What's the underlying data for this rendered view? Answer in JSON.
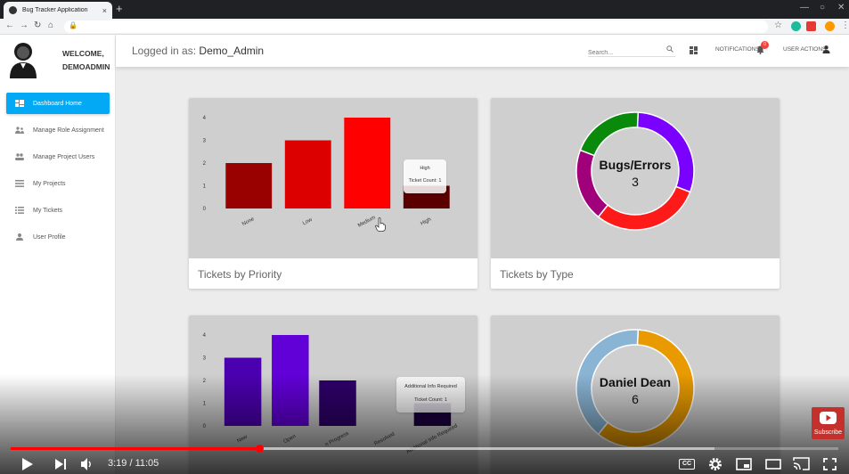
{
  "browser": {
    "tab_title": "Bug Tracker Application",
    "tab_close": "×",
    "new_tab": "+"
  },
  "sidebar": {
    "welcome": "WELCOME,",
    "username": "DEMOADMIN",
    "items": [
      {
        "label": "Dashboard Home",
        "icon": "dashboard-icon"
      },
      {
        "label": "Manage Role Assignment",
        "icon": "people-icon"
      },
      {
        "label": "Manage Project Users",
        "icon": "group-icon"
      },
      {
        "label": "My Projects",
        "icon": "list-icon"
      },
      {
        "label": "My Tickets",
        "icon": "list-icon"
      },
      {
        "label": "User Profile",
        "icon": "person-icon"
      }
    ]
  },
  "header": {
    "logged_prefix": "Logged in as:",
    "logged_user": "Demo_Admin",
    "search_placeholder": "Search...",
    "notifications": "NOTIFICATIONS",
    "notifications_count": "0",
    "user_actions": "USER ACTIONS"
  },
  "cards": {
    "priority_title": "Tickets by Priority",
    "type_title": "Tickets by Type"
  },
  "chart_data": [
    {
      "type": "bar",
      "categories": [
        "None",
        "Low",
        "Medium",
        "High"
      ],
      "values": [
        2,
        3,
        4,
        1
      ],
      "colors": [
        "#990000",
        "#dd0000",
        "#ff0000",
        "#5a0000"
      ],
      "ylim": [
        0,
        4
      ],
      "yticks": [
        "0",
        "1",
        "2",
        "3",
        "4"
      ],
      "tooltip": {
        "title": "High",
        "body": "Ticket Count: 1"
      }
    },
    {
      "type": "pie",
      "center_label": "Bugs/Errors",
      "center_value": "3",
      "slices": [
        {
          "color": "#7a00ff",
          "value": 3
        },
        {
          "color": "#ff1a1a",
          "value": 3
        },
        {
          "color": "#a0007a",
          "value": 2
        },
        {
          "color": "#0a8a0a",
          "value": 2
        }
      ]
    },
    {
      "type": "bar",
      "categories": [
        "New",
        "Open",
        "In Progress",
        "Resolved",
        "Additional Info Required"
      ],
      "tick_labels": [
        "New",
        "Open",
        "n Progress",
        "Resolved",
        "Additional Info Required"
      ],
      "values": [
        3,
        4,
        2,
        0,
        1
      ],
      "colors": [
        "#4b00b0",
        "#6200d8",
        "#2e006a",
        "#2e006a",
        "#1b0040"
      ],
      "ylim": [
        0,
        4
      ],
      "yticks": [
        "0",
        "1",
        "2",
        "3",
        "4"
      ],
      "tooltip": {
        "title": "Additional Info Required",
        "body": "Ticket Count: 1"
      }
    },
    {
      "type": "pie",
      "center_label": "Daniel Dean",
      "center_value": "6",
      "slices": [
        {
          "color": "#e89a00",
          "value": 6
        },
        {
          "color": "#8ab4d4",
          "value": 4
        }
      ]
    }
  ],
  "video": {
    "time": "3:19 / 11:05",
    "played_fraction": 0.3,
    "loaded_fraction": 0.85,
    "subscribe": "Subscribe",
    "cc": "CC"
  }
}
